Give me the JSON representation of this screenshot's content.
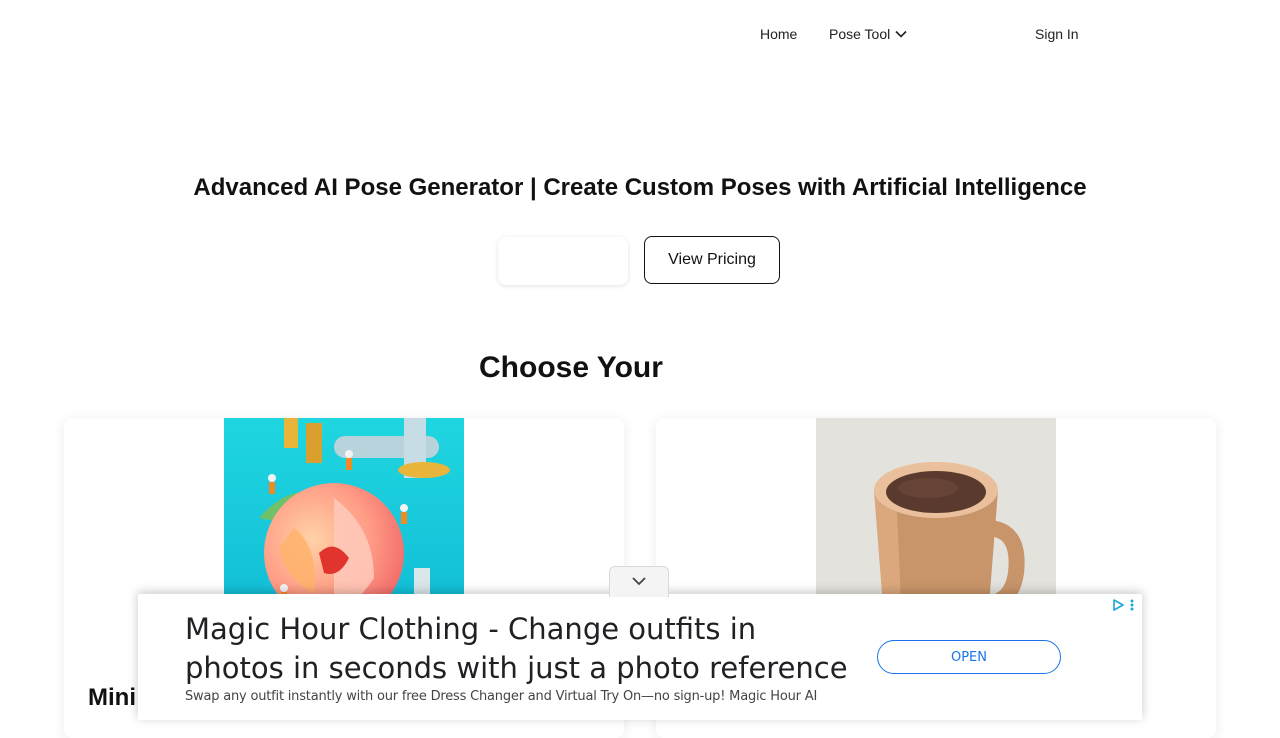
{
  "nav": {
    "home": "Home",
    "pose_tool": "Pose Tool",
    "sign_in": "Sign In"
  },
  "hero": {
    "title": "Advanced AI Pose Generator | Create Custom Poses with Artificial Intelligence",
    "pricing_button": "View Pricing",
    "section_title": "Choose Your"
  },
  "cards": [
    {
      "image": "peach-factory-illustration",
      "title": "Mini"
    },
    {
      "image": "coffee-mug-3d"
    }
  ],
  "ad": {
    "headline": "Magic Hour Clothing - Change outfits in photos in seconds with just a photo reference",
    "description": "Swap any outfit instantly with our free Dress Changer and Virtual Try On—no sign-up! Magic Hour AI",
    "cta": "OPEN",
    "accent": "#1a73e8",
    "icons": [
      "adchoices-icon",
      "ad-menu-icon",
      "chevron-down-icon"
    ]
  }
}
